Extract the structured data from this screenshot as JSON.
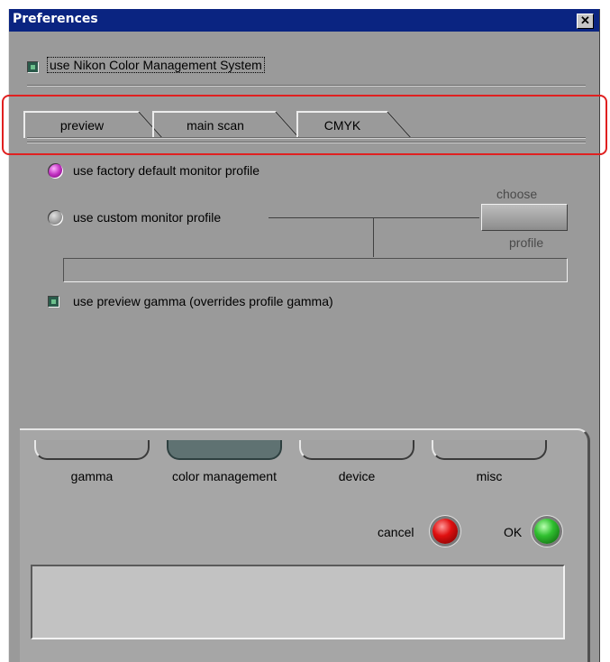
{
  "window": {
    "title": "Preferences",
    "close_glyph": "✕"
  },
  "cms_checkbox": {
    "label": "use Nikon Color Management System",
    "checked": true
  },
  "tabs": [
    {
      "label": "preview",
      "active": true
    },
    {
      "label": "main scan",
      "active": false
    },
    {
      "label": "CMYK",
      "active": false
    }
  ],
  "preview": {
    "factory_radio": {
      "label": "use factory default monitor profile",
      "selected": true
    },
    "custom_radio": {
      "label": "use custom monitor profile",
      "selected": false
    },
    "choose_label": "choose",
    "profile_label": "profile",
    "profile_path": "",
    "gamma_checkbox": {
      "label": "use preview gamma (overrides profile gamma)",
      "checked": true
    }
  },
  "nav": [
    {
      "label": "gamma",
      "active": false
    },
    {
      "label": "color management",
      "active": true
    },
    {
      "label": "device",
      "active": false
    },
    {
      "label": "misc",
      "active": false
    }
  ],
  "actions": {
    "cancel_label": "cancel",
    "ok_label": "OK"
  },
  "message": "",
  "colors": {
    "titlebar": "#0a2481",
    "panel": "#9a9a9a",
    "annotation": "#e02020"
  }
}
